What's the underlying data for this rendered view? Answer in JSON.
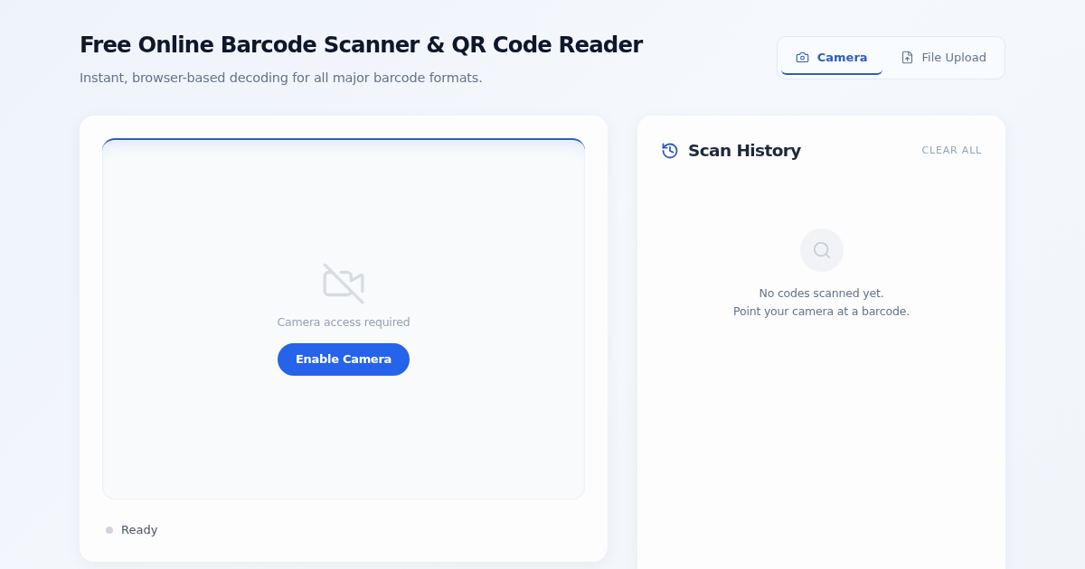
{
  "header": {
    "title": "Free Online Barcode Scanner & QR Code Reader",
    "subtitle": "Instant, browser-based decoding for all major barcode formats."
  },
  "tabs": [
    {
      "label": "Camera",
      "selected": true,
      "kind": "camera"
    },
    {
      "label": "File Upload",
      "selected": false,
      "kind": "upload"
    }
  ],
  "scanner": {
    "message": "Camera access required",
    "button": "Enable Camera",
    "status": {
      "label": "Ready",
      "active": false
    }
  },
  "history": {
    "title": "Scan History",
    "clear_button": "CLEAR ALL",
    "empty_lines": [
      "No codes scanned yet.",
      "Point your camera at a barcode."
    ]
  }
}
